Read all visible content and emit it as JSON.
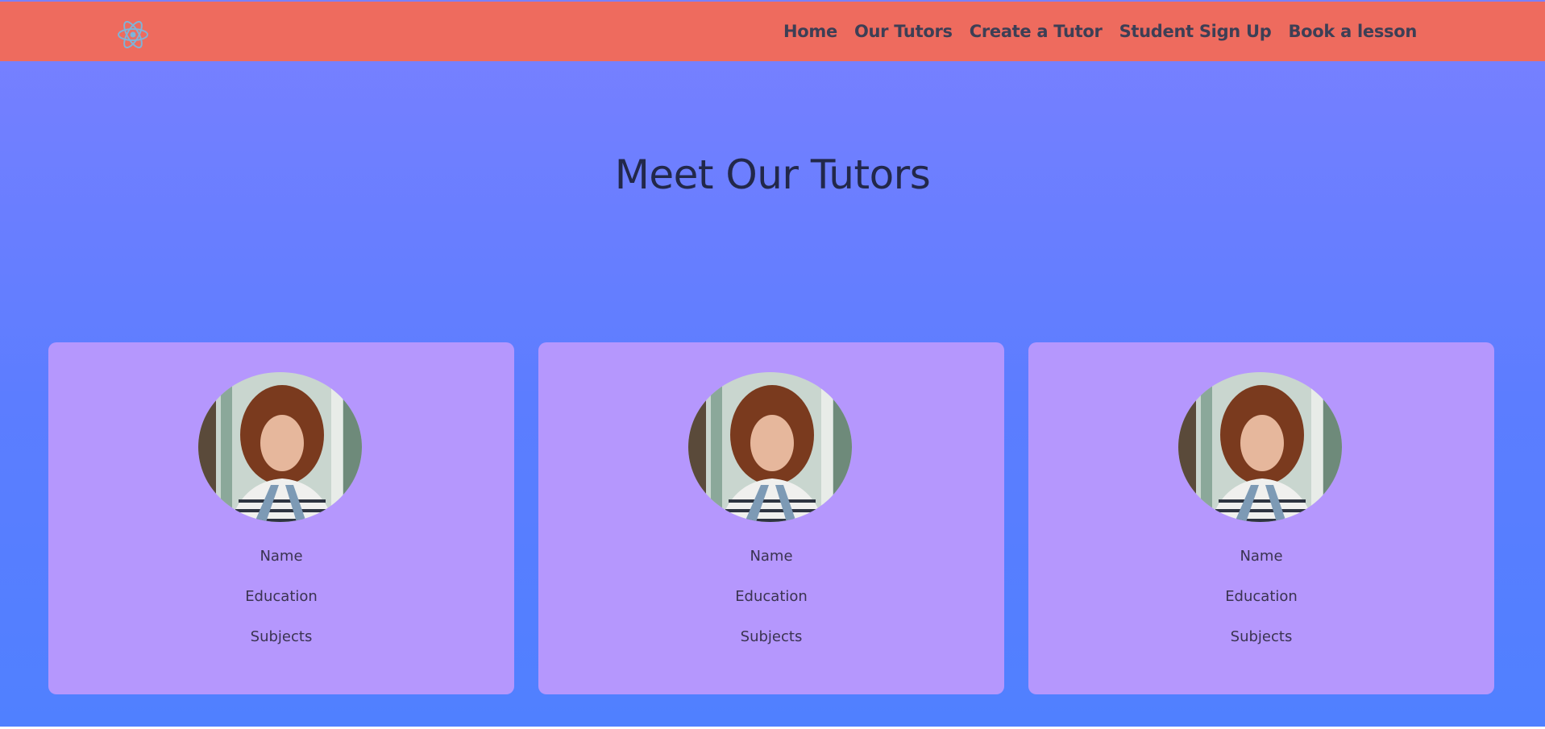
{
  "navbar": {
    "logo_icon": "react-atom-icon",
    "links": [
      {
        "label": "Home"
      },
      {
        "label": "Our Tutors"
      },
      {
        "label": "Create a Tutor"
      },
      {
        "label": "Student Sign Up"
      },
      {
        "label": "Book a lesson"
      }
    ]
  },
  "hero": {
    "title": "Meet Our Tutors"
  },
  "tutors": [
    {
      "photo_icon": "tutor-photo",
      "name": "Name",
      "education": "Education",
      "subjects": "Subjects"
    },
    {
      "photo_icon": "tutor-photo",
      "name": "Name",
      "education": "Education",
      "subjects": "Subjects"
    },
    {
      "photo_icon": "tutor-photo",
      "name": "Name",
      "education": "Education",
      "subjects": "Subjects"
    }
  ],
  "colors": {
    "navbar": "#ee6b5e",
    "background_top": "#7a80ff",
    "background_bottom": "#5080ff",
    "card": "#b597fd",
    "nav_text": "#3d3f55",
    "title_text": "#22284a"
  }
}
